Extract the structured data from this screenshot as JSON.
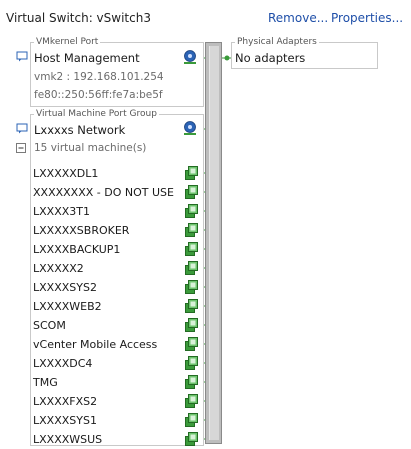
{
  "header": {
    "title": "Virtual Switch: vSwitch3",
    "remove_label": "Remove...",
    "properties_label": "Properties..."
  },
  "vmkernel": {
    "group_label": "VMkernel Port",
    "name": "Host Management",
    "ipv4": "vmk2 : 192.168.101.254",
    "ipv6": "fe80::250:56ff:fe7a:be5f"
  },
  "physical": {
    "group_label": "Physical Adapters",
    "value": "No adapters"
  },
  "vm_port_group": {
    "group_label": "Virtual Machine Port Group",
    "name": "Lxxxxs Network",
    "count_label": "15 virtual machine(s)",
    "vms": [
      "LXXXXXDL1",
      "XXXXXXXX - DO NOT USE",
      "LXXXX3T1",
      "LXXXXXSBROKER",
      "LXXXXBACKUP1",
      "LXXXXX2",
      "LXXXXSYS2",
      "LXXXXWEB2",
      "SCOM",
      "vCenter Mobile Access",
      "LXXXXDC4",
      "TMG",
      "LXXXXFXS2",
      "LXXXXSYS1",
      "LXXXXWSUS"
    ]
  },
  "colors": {
    "link": "#1f4fa8",
    "port_green": "#3a9a3a",
    "nic_blue": "#2b63b5",
    "switch_gray": "#bdbdbd"
  }
}
